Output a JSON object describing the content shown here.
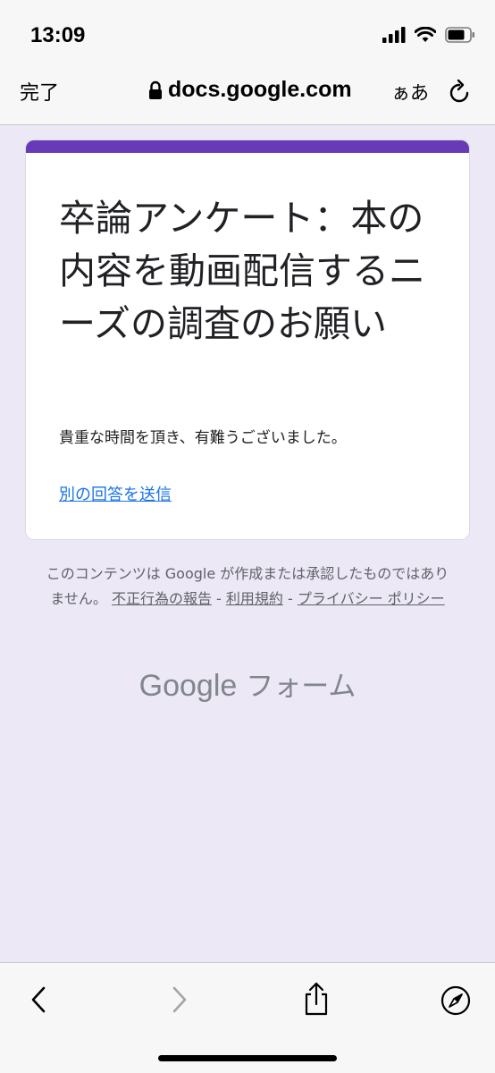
{
  "status_bar": {
    "time": "13:09",
    "icons": [
      "cellular-signal-icon",
      "wifi-icon",
      "battery-icon"
    ]
  },
  "address_bar": {
    "done_label": "完了",
    "url": "docs.google.com",
    "text_size_label": "ぁあ",
    "icons": [
      "lock-icon",
      "reload-icon"
    ]
  },
  "form": {
    "accent_color": "#673ab7",
    "title": "卒論アンケート：本の内容を動画配信するニーズの調査のお願い",
    "message": "貴重な時間を頂き、有難うございました。",
    "resubmit_link": "別の回答を送信"
  },
  "footer": {
    "disclaimer_text": "このコンテンツは Google が作成または承認したものではありません。",
    "report_link": "不正行為の報告",
    "separator": " - ",
    "terms_link": "利用規約",
    "privacy_link": "プライバシー ポリシー",
    "brand_logo": "Google",
    "brand_product": "フォーム"
  },
  "toolbar": {
    "icons": [
      "back-icon",
      "forward-icon",
      "share-icon",
      "compass-icon"
    ]
  }
}
